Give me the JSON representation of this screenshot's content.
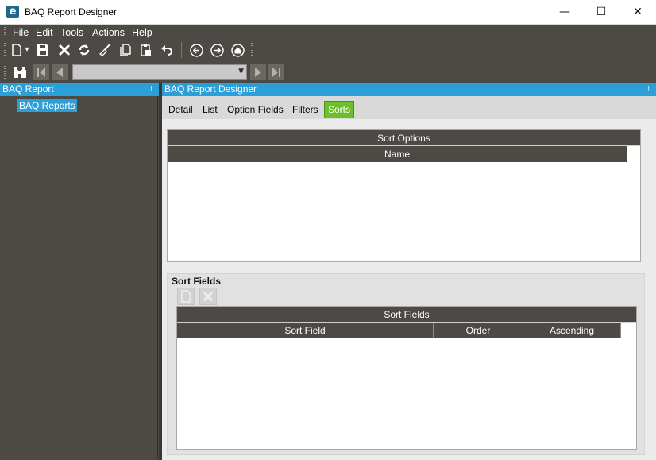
{
  "window": {
    "title": "BAQ Report Designer",
    "logo_letter": "e",
    "min_glyph": "—",
    "max_glyph": "☐",
    "close_glyph": "✕"
  },
  "menu": [
    "File",
    "Edit",
    "Tools",
    "Actions",
    "Help"
  ],
  "toolbar": {
    "icons": [
      "new-icon",
      "save-icon",
      "delete-icon",
      "refresh-icon",
      "clear-icon",
      "copy-icon",
      "paste-icon",
      "undo-icon",
      "back-icon",
      "forward-icon",
      "home-icon"
    ],
    "new_dropdown_glyph": "▾"
  },
  "navbar": {
    "icons": [
      "search-binoculars-icon",
      "first-record-icon",
      "previous-record-icon",
      "next-record-icon",
      "last-record-icon"
    ],
    "record_value": "",
    "combo_arrow": "▼"
  },
  "left_panel": {
    "header": "BAQ Report",
    "pin_glyph": "⊥",
    "tree": [
      "BAQ Reports"
    ]
  },
  "right_panel": {
    "header": "BAQ Report Designer",
    "pin_glyph": "⊥",
    "tabs": [
      "Detail",
      "List",
      "Option Fields",
      "Filters",
      "Sorts"
    ],
    "active_tab": "Sorts"
  },
  "sort_options": {
    "caption": "Sort Options",
    "columns": [
      "Name"
    ]
  },
  "sort_fields_group": {
    "title": "Sort Fields",
    "buttons": [
      "new-icon",
      "delete-icon"
    ],
    "grid_caption": "Sort Fields",
    "columns": [
      "Sort Field",
      "Order",
      "Ascending"
    ]
  },
  "colors": {
    "chrome": "#4d4a45",
    "accent_blue": "#2b9fd8",
    "active_tab": "#6cbf2b"
  }
}
